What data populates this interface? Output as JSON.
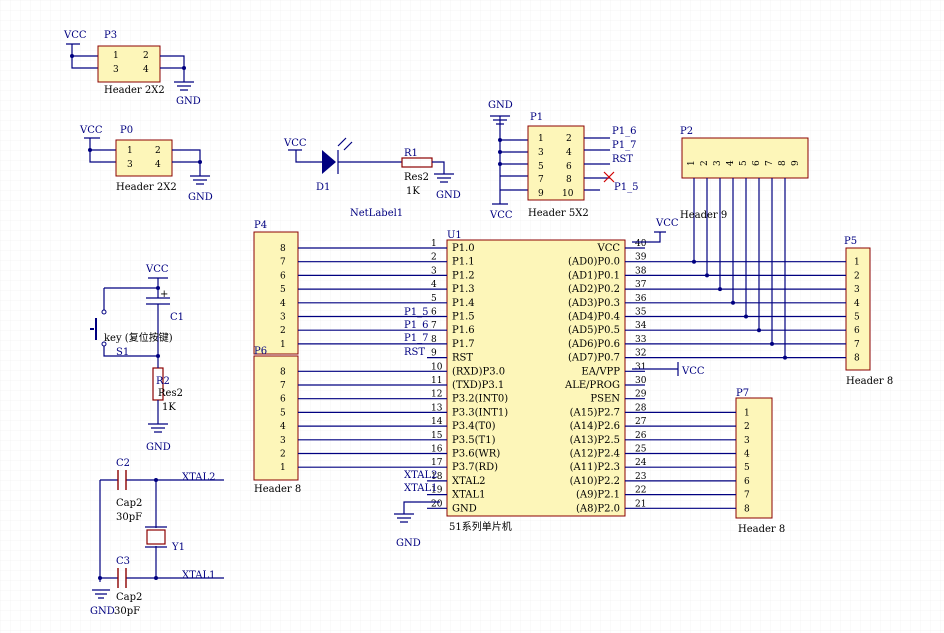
{
  "power": {
    "vcc": "VCC",
    "gnd": "GND"
  },
  "p3": {
    "designator": "P3",
    "comment": "Header 2X2",
    "pins": [
      "1",
      "2",
      "3",
      "4"
    ]
  },
  "p0": {
    "designator": "P0",
    "comment": "Header 2X2",
    "pins": [
      "1",
      "2",
      "3",
      "4"
    ]
  },
  "d1": {
    "designator": "D1",
    "net_label": "NetLabel1"
  },
  "r1": {
    "designator": "R1",
    "type": "Res2",
    "value": "1K"
  },
  "p1": {
    "designator": "P1",
    "comment": "Header 5X2",
    "pins": [
      "1",
      "2",
      "3",
      "4",
      "5",
      "6",
      "7",
      "8",
      "9",
      "10"
    ],
    "nets": [
      "P1_6",
      "P1_7",
      "RST",
      "P1_5"
    ]
  },
  "p2": {
    "designator": "P2",
    "comment": "Header 9",
    "pins": [
      "1",
      "2",
      "3",
      "4",
      "5",
      "6",
      "7",
      "8",
      "9"
    ]
  },
  "p4": {
    "designator": "P4",
    "pins": [
      "8",
      "7",
      "6",
      "5",
      "4",
      "3",
      "2",
      "1"
    ]
  },
  "p6": {
    "designator": "P6",
    "comment": "Header 8",
    "pins": [
      "8",
      "7",
      "6",
      "5",
      "4",
      "3",
      "2",
      "1"
    ]
  },
  "p5": {
    "designator": "P5",
    "comment": "Header 8",
    "pins": [
      "1",
      "2",
      "3",
      "4",
      "5",
      "6",
      "7",
      "8"
    ]
  },
  "p7": {
    "designator": "P7",
    "comment": "Header 8",
    "pins": [
      "1",
      "2",
      "3",
      "4",
      "5",
      "6",
      "7",
      "8"
    ]
  },
  "reset": {
    "c1": "C1",
    "switch_label": "key (复位按键)",
    "s1": "S1",
    "r2": "R2",
    "r2_type": "Res2",
    "r2_value": "1K"
  },
  "crystal": {
    "c2": "C2",
    "c3": "C3",
    "cap_type": "Cap2",
    "cap_value": "30pF",
    "y1": "Y1",
    "xtal2": "XTAL2",
    "xtal1": "XTAL1"
  },
  "u1": {
    "designator": "U1",
    "comment": "51系列单片机",
    "left_pins": [
      {
        "num": "1",
        "name": "P1.0"
      },
      {
        "num": "2",
        "name": "P1.1"
      },
      {
        "num": "3",
        "name": "P1.2"
      },
      {
        "num": "4",
        "name": "P1.3"
      },
      {
        "num": "5",
        "name": "P1.4"
      },
      {
        "num": "6",
        "name": "P1.5"
      },
      {
        "num": "7",
        "name": "P1.6"
      },
      {
        "num": "8",
        "name": "P1.7"
      },
      {
        "num": "9",
        "name": "RST"
      },
      {
        "num": "10",
        "name": "(RXD)P3.0"
      },
      {
        "num": "11",
        "name": "(TXD)P3.1"
      },
      {
        "num": "12",
        "name": "P3.2(INT0)"
      },
      {
        "num": "13",
        "name": "P3.3(INT1)"
      },
      {
        "num": "14",
        "name": "P3.4(T0)"
      },
      {
        "num": "15",
        "name": "P3.5(T1)"
      },
      {
        "num": "16",
        "name": "P3.6(WR)"
      },
      {
        "num": "17",
        "name": "P3.7(RD)"
      },
      {
        "num": "18",
        "name": "XTAL2"
      },
      {
        "num": "19",
        "name": "XTAL1"
      },
      {
        "num": "20",
        "name": "GND"
      }
    ],
    "left_nets": [
      "P1_5",
      "P1_6",
      "P1_7",
      "RST",
      "XTAL2",
      "XTAL1"
    ],
    "right_pins": [
      {
        "num": "40",
        "name": "VCC"
      },
      {
        "num": "39",
        "name": "(AD0)P0.0"
      },
      {
        "num": "38",
        "name": "(AD1)P0.1"
      },
      {
        "num": "37",
        "name": "(AD2)P0.2"
      },
      {
        "num": "36",
        "name": "(AD3)P0.3"
      },
      {
        "num": "35",
        "name": "(AD4)P0.4"
      },
      {
        "num": "34",
        "name": "(AD5)P0.5"
      },
      {
        "num": "33",
        "name": "(AD6)P0.6"
      },
      {
        "num": "32",
        "name": "(AD7)P0.7"
      },
      {
        "num": "31",
        "name": "EA/VPP"
      },
      {
        "num": "30",
        "name": "ALE/PROG"
      },
      {
        "num": "29",
        "name": "PSEN"
      },
      {
        "num": "28",
        "name": "(A15)P2.7"
      },
      {
        "num": "27",
        "name": "(A14)P2.6"
      },
      {
        "num": "26",
        "name": "(A13)P2.5"
      },
      {
        "num": "25",
        "name": "(A12)P2.4"
      },
      {
        "num": "24",
        "name": "(A11)P2.3"
      },
      {
        "num": "23",
        "name": "(A10)P2.2"
      },
      {
        "num": "22",
        "name": "(A9)P2.1"
      },
      {
        "num": "21",
        "name": "(A8)P2.0"
      }
    ]
  },
  "colors": {
    "wire": "#000080",
    "body_fill": "#fdf6b9",
    "body_stroke": "#8b0000"
  }
}
